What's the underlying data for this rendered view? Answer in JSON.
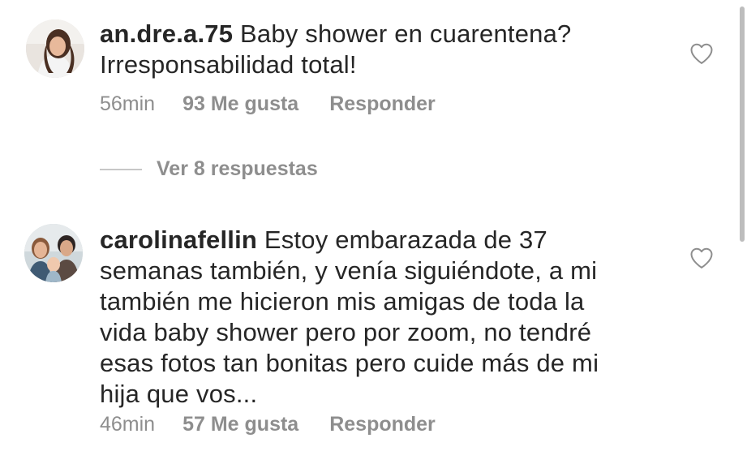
{
  "comments": [
    {
      "username": "an.dre.a.75",
      "text_lines": [
        "Baby shower en cuarentena?",
        "Irresponsabilidad total!"
      ],
      "time": "56min",
      "likes": "93 Me gusta",
      "reply": "Responder",
      "like_icon": "heart-outline-icon"
    },
    {
      "username": "carolinafellin",
      "text_lines": [
        "Estoy embarazada de 37",
        "semanas también, y venía siguiéndote, a mi",
        "también me hicieron mis amigas de toda la",
        "vida baby shower pero por zoom, no tendré",
        "esas fotos tan bonitas pero cuide más de mi",
        "hija que vos..."
      ],
      "time": "46min",
      "likes": "57 Me gusta",
      "reply": "Responder",
      "like_icon": "heart-outline-icon"
    }
  ],
  "view_replies": "Ver 8 respuestas",
  "colors": {
    "text": "#262626",
    "secondary": "#8e8e8e",
    "divider": "#c7c7c7",
    "background": "#ffffff"
  }
}
